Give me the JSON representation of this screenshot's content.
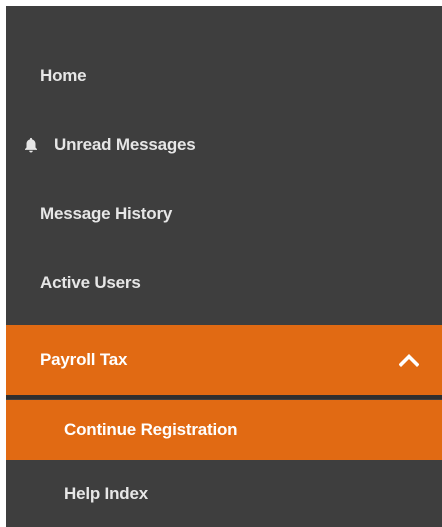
{
  "sidebar": {
    "items": [
      {
        "label": "Home"
      },
      {
        "label": "Unread Messages",
        "icon": "bell-icon"
      },
      {
        "label": "Message History"
      },
      {
        "label": "Active Users"
      },
      {
        "label": "Payroll Tax",
        "expanded": true,
        "icon": "chevron-up-icon"
      }
    ],
    "subitems": [
      {
        "label": "Continue Registration",
        "active": true
      },
      {
        "label": "Help Index"
      }
    ]
  },
  "colors": {
    "sidebar_bg": "#3e3e3e",
    "accent": "#e16a13",
    "text": "#e6e6e6",
    "text_active": "#ffffff"
  }
}
